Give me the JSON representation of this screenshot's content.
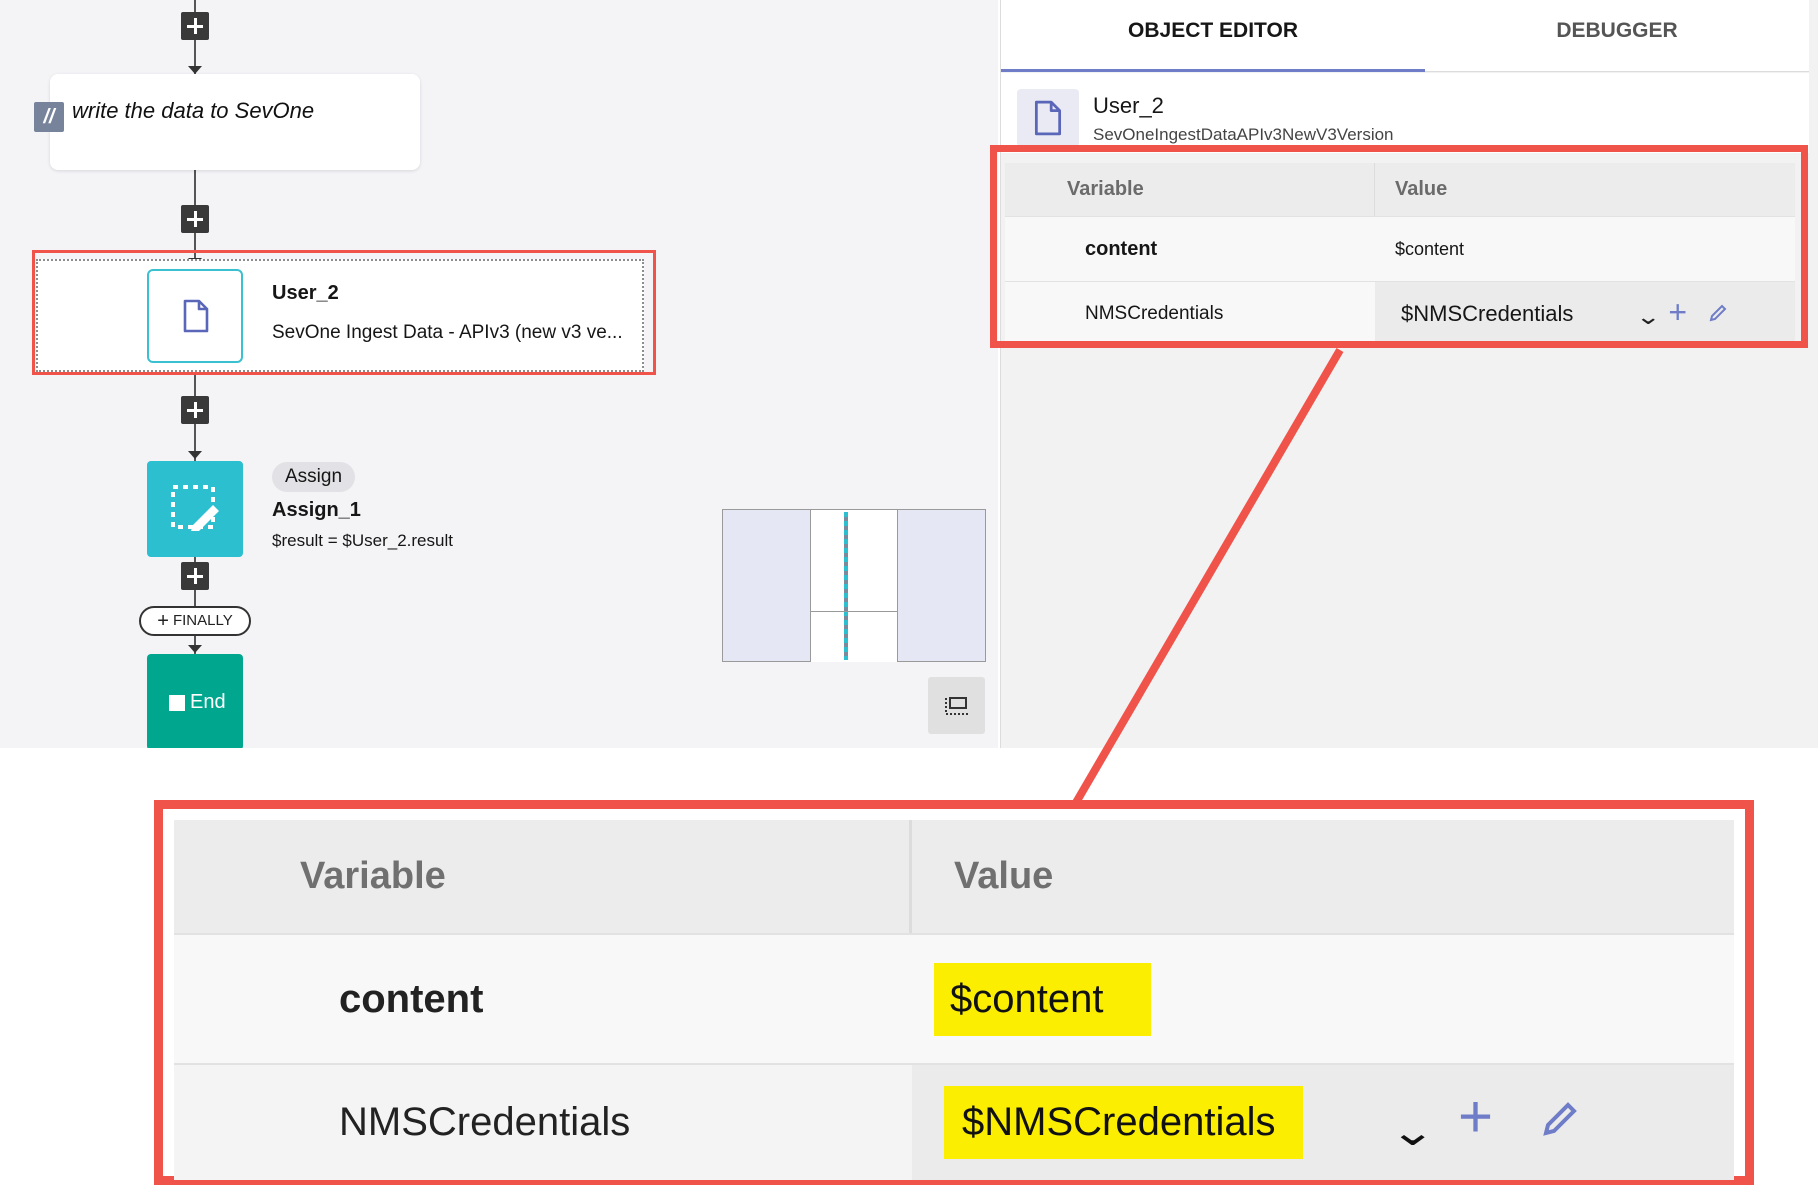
{
  "canvas": {
    "comment_text": "write the data to SevOne",
    "comment_icon": "//",
    "user_node": {
      "title": "User_2",
      "subtitle": "SevOne Ingest Data - APIv3 (new v3 ve..."
    },
    "assign_node": {
      "badge": "Assign",
      "title": "Assign_1",
      "subtitle": "$result = $User_2.result"
    },
    "finally_label": "FINALLY",
    "end_label": "End"
  },
  "panel": {
    "tabs": [
      {
        "label": "OBJECT EDITOR",
        "active": true
      },
      {
        "label": "DEBUGGER",
        "active": false
      }
    ],
    "object": {
      "name": "User_2",
      "type": "SevOneIngestDataAPIv3NewV3Version"
    },
    "table": {
      "headers": [
        "Variable",
        "Value"
      ],
      "rows": [
        {
          "variable": "content",
          "value": "$content"
        },
        {
          "variable": "NMSCredentials",
          "value": "$NMSCredentials"
        }
      ]
    }
  },
  "zoom": {
    "headers": [
      "Variable",
      "Value"
    ],
    "rows": [
      {
        "variable": "content",
        "value": "$content"
      },
      {
        "variable": "NMSCredentials",
        "value": "$NMSCredentials"
      }
    ]
  },
  "colors": {
    "highlight_red": "#f0534a",
    "highlight_yellow": "#fbee00",
    "accent": "#6f7dc8",
    "teal": "#2bbfd0",
    "end_green": "#00a78e"
  },
  "icons": {
    "document": "document-icon",
    "assign": "assign-edit-icon",
    "add": "plus-icon",
    "edit": "pencil-icon",
    "dropdown": "chevron-down-icon",
    "fit": "fit-to-screen-icon"
  }
}
